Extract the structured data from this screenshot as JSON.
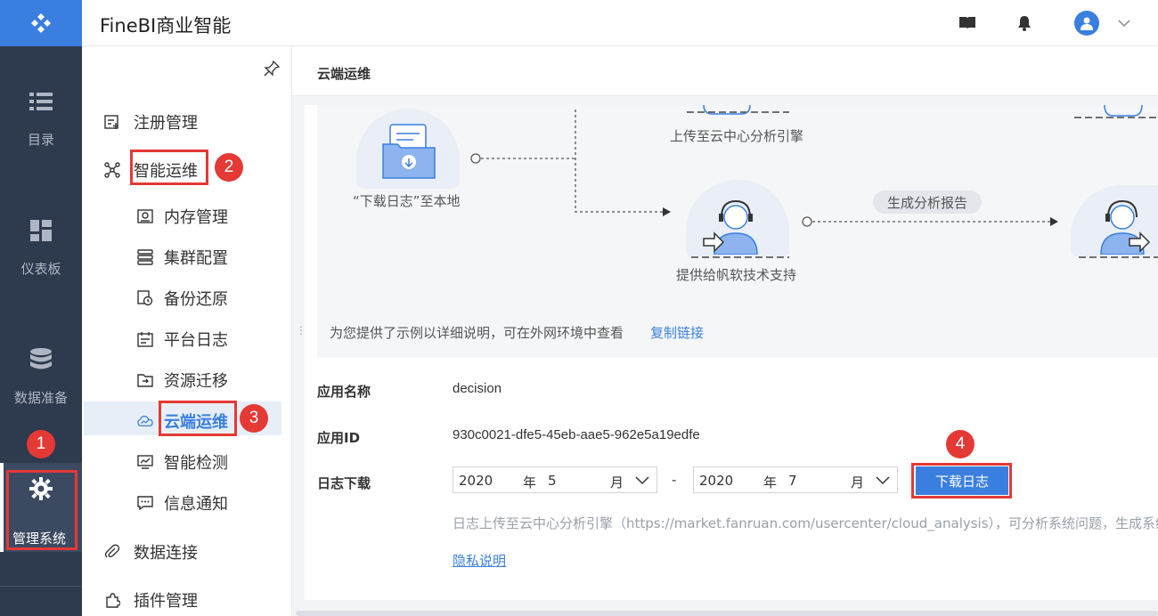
{
  "header": {
    "app_title": "FineBI商业智能"
  },
  "rail": {
    "items": [
      {
        "label": "目录",
        "icon": "list-icon"
      },
      {
        "label": "仪表板",
        "icon": "dashboard-icon"
      },
      {
        "label": "数据准备",
        "icon": "database-icon"
      },
      {
        "label": "管理系统",
        "icon": "gear-icon"
      }
    ]
  },
  "subnav": {
    "items": [
      {
        "label": "注册管理",
        "icon": "register-icon"
      },
      {
        "label": "智能运维",
        "icon": "ops-icon"
      },
      {
        "label": "内存管理",
        "icon": "memory-icon"
      },
      {
        "label": "集群配置",
        "icon": "cluster-icon"
      },
      {
        "label": "备份还原",
        "icon": "backup-icon"
      },
      {
        "label": "平台日志",
        "icon": "log-icon"
      },
      {
        "label": "资源迁移",
        "icon": "migrate-icon"
      },
      {
        "label": "云端运维",
        "icon": "cloud-icon"
      },
      {
        "label": "智能检测",
        "icon": "monitor-icon"
      },
      {
        "label": "信息通知",
        "icon": "message-icon"
      },
      {
        "label": "数据连接",
        "icon": "link-icon"
      },
      {
        "label": "插件管理",
        "icon": "plugin-icon"
      }
    ]
  },
  "annotations": [
    "1",
    "2",
    "3",
    "4"
  ],
  "main": {
    "page_title": "云端运维",
    "flow": {
      "download_local": "“下载日志”至本地",
      "upload_cloud": "上传至云中心分析引擎",
      "provide_support": "提供给帆软技术支持",
      "generate_report": "生成分析报告",
      "note": "为您提供了示例以详细说明，可在外网环境中查看",
      "copy_link": "复制链接"
    },
    "app_name_label": "应用名称",
    "app_name_value": "decision",
    "app_id_label": "应用ID",
    "app_id_value": "930c0021-dfe5-45eb-aae5-962e5a19edfe",
    "log_download_label": "日志下载",
    "from": {
      "year": "2020",
      "year_unit": "年",
      "month": "5",
      "month_unit": "月"
    },
    "to": {
      "year": "2020",
      "year_unit": "年",
      "month": "7",
      "month_unit": "月"
    },
    "range_sep": "-",
    "download_button": "下载日志",
    "hint": "日志上传至云中心分析引擎（https://market.fanruan.com/usercenter/cloud_analysis），可分析系统问题，生成系统",
    "privacy_link": "隐私说明"
  },
  "colors": {
    "accent": "#3a7fe0",
    "rail": "#2e3a4d",
    "annotation": "#e53935"
  }
}
